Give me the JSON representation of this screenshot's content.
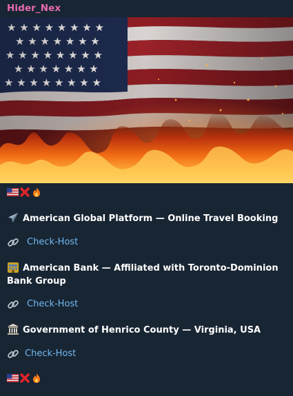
{
  "message": {
    "sender": "Hider_Nex",
    "media_alt": "American flag burning",
    "header_emojis": [
      "us-flag-icon",
      "cross-mark-icon",
      "fire-icon"
    ],
    "entries": [
      {
        "icon": "airplane-icon",
        "title": "American Global Platform — Online Travel Booking",
        "link_label": "Check-Host"
      },
      {
        "icon": "bank-icon",
        "title": "American Bank — Affiliated with Toronto-Dominion Bank Group",
        "link_label": "Check-Host"
      },
      {
        "icon": "classical-building-icon",
        "title": "Government of Henrico County — Virginia, USA",
        "link_label": "Check-Host"
      }
    ],
    "footer_emojis": [
      "us-flag-icon",
      "cross-mark-icon",
      "fire-icon"
    ]
  },
  "colors": {
    "background": "#182533",
    "sender": "#e56bae",
    "link": "#71baf2",
    "text": "#ffffff"
  }
}
